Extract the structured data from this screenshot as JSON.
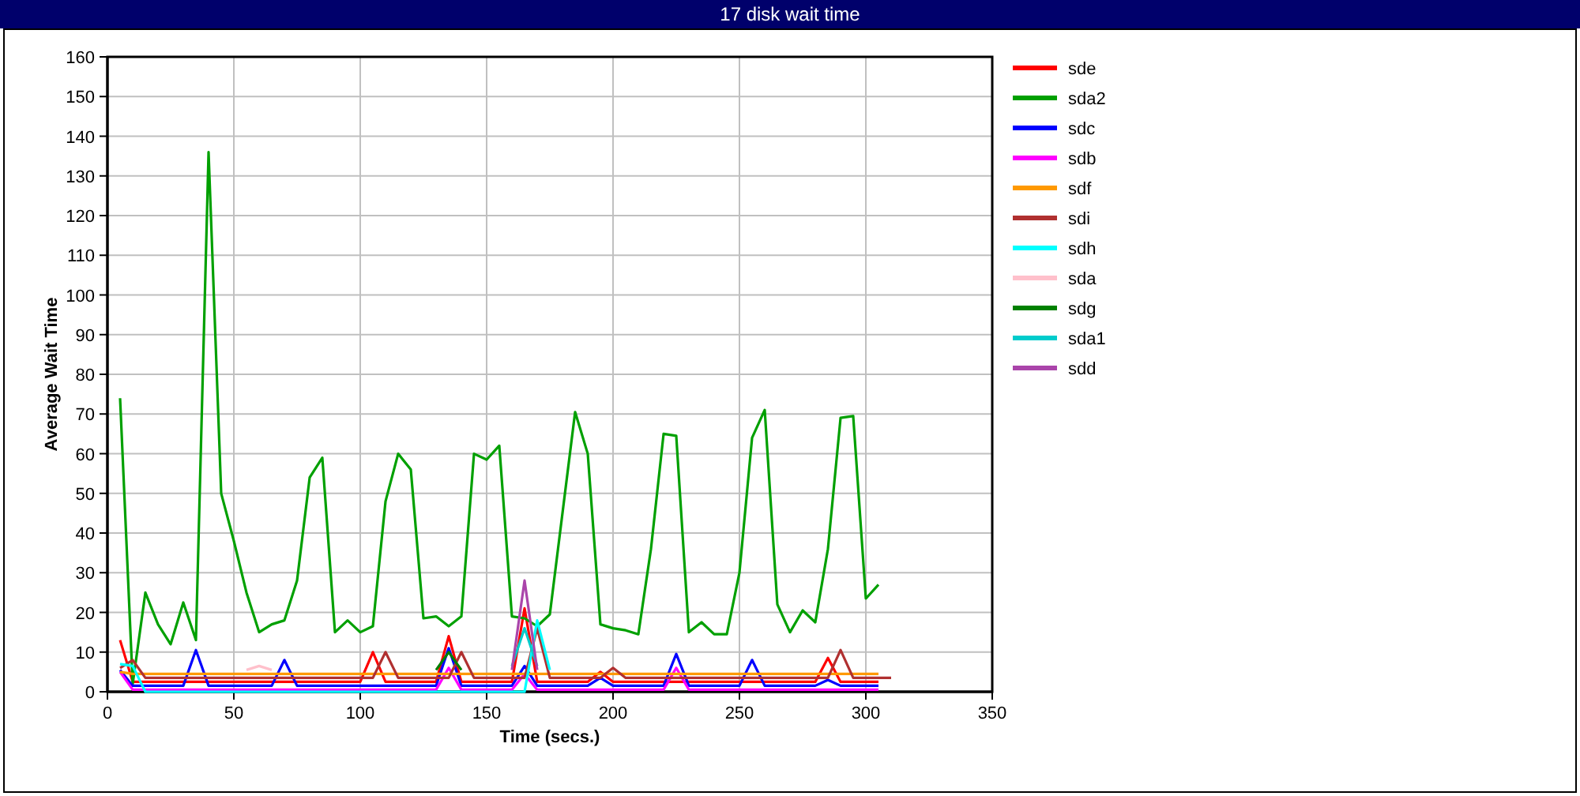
{
  "window": {
    "title": "17 disk wait time"
  },
  "chart_data": {
    "type": "line",
    "xlabel": "Time (secs.)",
    "ylabel": "Average Wait Time",
    "xlim": [
      0,
      350
    ],
    "ylim": [
      0,
      160
    ],
    "grid": true,
    "legend": true,
    "xticks": [
      0,
      50,
      100,
      150,
      200,
      250,
      300,
      350
    ],
    "yticks": [
      0,
      10,
      20,
      30,
      40,
      50,
      60,
      70,
      80,
      90,
      100,
      110,
      120,
      130,
      140,
      150,
      160
    ],
    "x": [
      5,
      10,
      15,
      20,
      25,
      30,
      35,
      40,
      45,
      50,
      55,
      60,
      65,
      70,
      75,
      80,
      85,
      90,
      95,
      100,
      105,
      110,
      115,
      120,
      125,
      130,
      135,
      140,
      145,
      150,
      155,
      160,
      165,
      170,
      175,
      180,
      185,
      190,
      195,
      200,
      205,
      210,
      215,
      220,
      225,
      230,
      235,
      240,
      245,
      250,
      255,
      260,
      265,
      270,
      275,
      280,
      285,
      290,
      295,
      300,
      305,
      310
    ],
    "series": [
      {
        "name": "sde",
        "color": "#ff0000",
        "values": [
          13,
          2.5,
          2.5,
          2.5,
          2.5,
          2.5,
          2.5,
          2.5,
          2.5,
          2.5,
          2.5,
          2.5,
          2.5,
          2.5,
          2.5,
          2.5,
          2.5,
          2.5,
          2.5,
          2.5,
          10,
          2.5,
          2.5,
          2.5,
          2.5,
          2.5,
          14,
          2.5,
          2.5,
          2.5,
          2.5,
          2.5,
          21,
          2.5,
          2.5,
          2.5,
          2.5,
          2.5,
          5,
          2.5,
          2.5,
          2.5,
          2.5,
          2.5,
          2.5,
          2.5,
          2.5,
          2.5,
          2.5,
          2.5,
          2.5,
          2.5,
          2.5,
          2.5,
          2.5,
          2.5,
          8.5,
          2.5,
          2.5,
          2.5,
          2.5,
          null
        ]
      },
      {
        "name": "sda2",
        "color": "#00a000",
        "values": [
          74,
          2,
          25,
          17,
          12,
          22.5,
          13,
          136,
          50,
          38,
          25,
          15,
          17,
          18,
          28,
          54,
          59,
          15,
          18,
          15,
          16.5,
          48,
          60,
          56,
          18.5,
          19,
          16.5,
          19,
          60,
          58.5,
          62,
          19,
          18.5,
          16.5,
          19.5,
          45,
          70.5,
          60,
          17,
          16,
          15.5,
          14.5,
          36,
          65,
          64.5,
          15,
          17.5,
          14.5,
          14.5,
          30,
          64,
          71,
          22,
          15,
          20.5,
          17.5,
          36,
          69,
          69.5,
          23.5,
          27,
          null
        ]
      },
      {
        "name": "sdc",
        "color": "#0000ff",
        "values": [
          5.5,
          1.5,
          1.5,
          1.5,
          1.5,
          1.5,
          10.5,
          1.5,
          1.5,
          1.5,
          1.5,
          1.5,
          1.5,
          8,
          1.5,
          1.5,
          1.5,
          1.5,
          1.5,
          1.5,
          1.5,
          1.5,
          1.5,
          1.5,
          1.5,
          1.5,
          11,
          1.5,
          1.5,
          1.5,
          1.5,
          1.5,
          6.5,
          1.5,
          1.5,
          1.5,
          1.5,
          1.5,
          3.5,
          1.5,
          1.5,
          1.5,
          1.5,
          1.5,
          9.5,
          1.5,
          1.5,
          1.5,
          1.5,
          1.5,
          8,
          1.5,
          1.5,
          1.5,
          1.5,
          1.5,
          3,
          1.5,
          1.5,
          1.5,
          1.5,
          null
        ]
      },
      {
        "name": "sdb",
        "color": "#ff00ff",
        "values": [
          5,
          0.5,
          0.5,
          0.5,
          0.5,
          0.5,
          0.5,
          0.5,
          0.5,
          0.5,
          0.5,
          0.5,
          0.5,
          0.5,
          0.5,
          0.5,
          0.5,
          0.5,
          0.5,
          0.5,
          0.5,
          0.5,
          0.5,
          0.5,
          0.5,
          0.5,
          6,
          0.5,
          0.5,
          0.5,
          0.5,
          0.5,
          4.5,
          0.5,
          0.5,
          0.5,
          0.5,
          0.5,
          0.5,
          0.5,
          0.5,
          0.5,
          0.5,
          0.5,
          6,
          0.5,
          0.5,
          0.5,
          0.5,
          0.5,
          0.5,
          0.5,
          0.5,
          0.5,
          0.5,
          0.5,
          0.5,
          0.5,
          0.5,
          0.5,
          0.5,
          null
        ]
      },
      {
        "name": "sdf",
        "color": "#ff9900",
        "values": [
          5,
          4.5,
          4.5,
          4.5,
          4.5,
          4.5,
          4.5,
          4.5,
          4.5,
          4.5,
          4.5,
          4.5,
          4.5,
          4.5,
          4.5,
          4.5,
          4.5,
          4.5,
          4.5,
          4.5,
          4.5,
          4.5,
          4.5,
          4.5,
          4.5,
          4.5,
          4.5,
          4.5,
          4.5,
          4.5,
          4.5,
          4.5,
          4.5,
          4.5,
          4.5,
          4.5,
          4.5,
          4.5,
          4.5,
          4.5,
          4.5,
          4.5,
          4.5,
          4.5,
          4.5,
          4.5,
          4.5,
          4.5,
          4.5,
          4.5,
          4.5,
          4.5,
          4.5,
          4.5,
          4.5,
          4.5,
          4.5,
          4.5,
          4.5,
          4.5,
          4.5,
          null
        ]
      },
      {
        "name": "sdi",
        "color": "#b03030",
        "values": [
          6,
          8,
          3.5,
          3.5,
          3.5,
          3.5,
          3.5,
          3.5,
          3.5,
          3.5,
          3.5,
          3.5,
          3.5,
          3.5,
          3.5,
          3.5,
          3.5,
          3.5,
          3.5,
          3.5,
          3.5,
          10,
          3.5,
          3.5,
          3.5,
          3.5,
          3.5,
          10,
          3.5,
          3.5,
          3.5,
          3.5,
          3.5,
          16,
          3.5,
          3.5,
          3.5,
          3.5,
          3.5,
          6,
          3.5,
          3.5,
          3.5,
          3.5,
          3.5,
          3.5,
          3.5,
          3.5,
          3.5,
          3.5,
          3.5,
          3.5,
          3.5,
          3.5,
          3.5,
          3.5,
          3.5,
          10.5,
          3.5,
          3.5,
          3.5,
          3.5
        ]
      },
      {
        "name": "sdh",
        "color": "#00ffff",
        "values": [
          7,
          6.5,
          0,
          0,
          0,
          0,
          0,
          0,
          0,
          0,
          0,
          0,
          0,
          0,
          0,
          0,
          0,
          0,
          0,
          0,
          0,
          0,
          0,
          0,
          0,
          0,
          0,
          0,
          0,
          0,
          0,
          0,
          0,
          18,
          5.5,
          null,
          null,
          null,
          null,
          null,
          null,
          null,
          null,
          null,
          null,
          null,
          null,
          null,
          null,
          null,
          null,
          null,
          null,
          null,
          null,
          null,
          null,
          null,
          null,
          null,
          null,
          null
        ]
      },
      {
        "name": "sda",
        "color": "#ffc0cb",
        "values": [
          null,
          null,
          null,
          null,
          null,
          null,
          null,
          null,
          null,
          null,
          5.5,
          6.5,
          5.5,
          null,
          null,
          null,
          null,
          null,
          null,
          null,
          null,
          null,
          null,
          null,
          null,
          null,
          null,
          null,
          null,
          null,
          null,
          null,
          null,
          null,
          null,
          null,
          null,
          null,
          null,
          null,
          null,
          null,
          null,
          null,
          null,
          null,
          null,
          null,
          null,
          null,
          null,
          null,
          null,
          null,
          null,
          null,
          null,
          null,
          null,
          null,
          null,
          null
        ]
      },
      {
        "name": "sdg",
        "color": "#008000",
        "values": [
          null,
          null,
          null,
          null,
          null,
          null,
          null,
          null,
          null,
          null,
          null,
          null,
          null,
          null,
          null,
          null,
          null,
          null,
          null,
          null,
          null,
          null,
          null,
          null,
          null,
          5.5,
          10,
          5.5,
          null,
          null,
          null,
          null,
          null,
          null,
          null,
          null,
          null,
          null,
          null,
          null,
          null,
          null,
          null,
          null,
          null,
          null,
          null,
          null,
          null,
          null,
          null,
          null,
          null,
          null,
          null,
          null,
          null,
          null,
          null,
          null,
          null,
          null
        ]
      },
      {
        "name": "sda1",
        "color": "#00cccc",
        "values": [
          null,
          null,
          null,
          null,
          null,
          null,
          null,
          null,
          null,
          null,
          null,
          null,
          null,
          null,
          null,
          null,
          null,
          null,
          null,
          null,
          null,
          null,
          null,
          null,
          null,
          null,
          null,
          null,
          null,
          null,
          null,
          6.5,
          16,
          6.5,
          null,
          null,
          null,
          null,
          null,
          null,
          null,
          null,
          null,
          null,
          null,
          null,
          null,
          null,
          null,
          null,
          null,
          null,
          null,
          null,
          null,
          null,
          null,
          null,
          null,
          null,
          null,
          null
        ]
      },
      {
        "name": "sdd",
        "color": "#aa44aa",
        "values": [
          null,
          null,
          null,
          null,
          null,
          null,
          null,
          null,
          null,
          null,
          null,
          null,
          null,
          null,
          null,
          null,
          null,
          null,
          null,
          null,
          null,
          null,
          null,
          null,
          null,
          null,
          null,
          null,
          null,
          null,
          null,
          5.5,
          28,
          5.5,
          null,
          null,
          null,
          null,
          null,
          null,
          null,
          null,
          null,
          null,
          null,
          null,
          null,
          null,
          null,
          null,
          null,
          null,
          null,
          null,
          null,
          null,
          null,
          null,
          null,
          null,
          null,
          null
        ]
      }
    ]
  }
}
